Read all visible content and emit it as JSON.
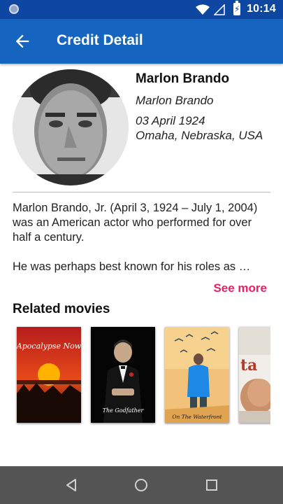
{
  "status_bar": {
    "time": "10:14",
    "icons": [
      "app-notification-icon",
      "wifi-icon",
      "signal-icon",
      "battery-charging-icon"
    ]
  },
  "app_bar": {
    "title": "Credit Detail",
    "back_icon": "arrow-back-icon"
  },
  "person": {
    "name": "Marlon Brando",
    "known_as": "Marlon Brando",
    "birth_date": "03 April 1924",
    "birth_place": "Omaha, Nebraska, USA"
  },
  "biography": {
    "paragraph1": "Marlon Brando, Jr. (April 3, 1924 – July 1, 2004) was an American actor who performed for over half a century.",
    "paragraph2": "He was perhaps best known for his roles as …",
    "see_more": "See more"
  },
  "related": {
    "title": "Related movies",
    "movies": [
      {
        "poster_text": "Apocalypse Now"
      },
      {
        "poster_text": "The Godfather"
      },
      {
        "poster_text": "On The Waterfront"
      },
      {
        "poster_text": "ta"
      }
    ]
  },
  "nav_bar": {
    "icons": [
      "back-triangle-icon",
      "home-circle-icon",
      "recents-square-icon"
    ]
  },
  "colors": {
    "status_bar": "#0d47a1",
    "app_bar": "#1565c0",
    "accent": "#e91e63",
    "nav_bar": "#545454"
  }
}
